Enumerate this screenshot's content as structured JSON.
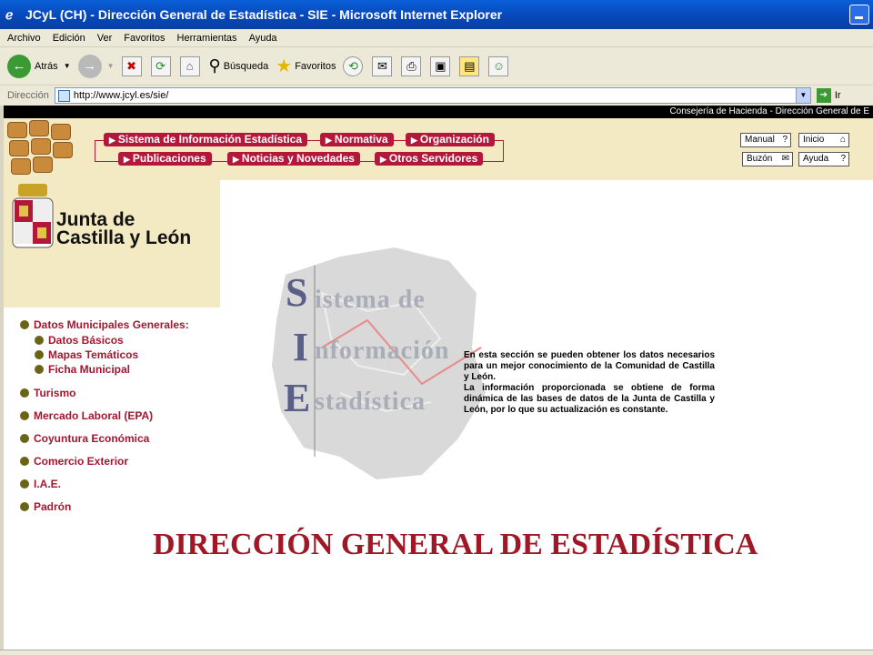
{
  "window": {
    "title": "JCyL (CH) - Dirección General de Estadística - SIE - Microsoft Internet Explorer"
  },
  "menubar": {
    "items": [
      "Archivo",
      "Edición",
      "Ver",
      "Favoritos",
      "Herramientas",
      "Ayuda"
    ]
  },
  "toolbar": {
    "back_label": "Atrás",
    "search_label": "Búsqueda",
    "favorites_label": "Favoritos"
  },
  "addressbar": {
    "label": "Dirección",
    "url": "http://www.jcyl.es/sie/",
    "go_label": "Ir"
  },
  "page": {
    "top_strip": "Consejería de Hacienda - Dirección General de E",
    "nav": {
      "sie": "Sistema de Información Estadística",
      "normativa": "Normativa",
      "organizacion": "Organización",
      "publicaciones": "Publicaciones",
      "noticias": "Noticias y Novedades",
      "otros": "Otros Servidores"
    },
    "utility": {
      "manual": "Manual",
      "inicio": "Inicio",
      "buzon": "Buzón",
      "ayuda": "Ayuda"
    },
    "logo_line1": "Junta de",
    "logo_line2": "Castilla y León",
    "sie_letters": [
      "S",
      "I",
      "E"
    ],
    "sie_words": [
      "istema de",
      "nformación",
      "stadística"
    ],
    "description_1": "En esta sección se pueden obtener los datos necesarios para un mejor conocimiento de la Comunidad de Castilla y León.",
    "description_2": "La información proporcionada se obtiene de forma dinámica de las bases de datos de la Junta de Castilla y León, por lo que su actualización es constante.",
    "menu": {
      "datos_municipales": "Datos Municipales Generales:",
      "datos_basicos": "Datos Básicos",
      "mapas": "Mapas Temáticos",
      "ficha": "Ficha Municipal",
      "turismo": "Turismo",
      "mercado": "Mercado Laboral (EPA)",
      "coyuntura": "Coyuntura Económica",
      "comercio": "Comercio Exterior",
      "iae": "I.A.E.",
      "padron": "Padrón"
    },
    "headline": "DIRECCIÓN GENERAL DE ESTADÍSTICA"
  },
  "colors": {
    "accent": "#b3183b",
    "band": "#f3e9c3",
    "headline": "#a01826"
  }
}
